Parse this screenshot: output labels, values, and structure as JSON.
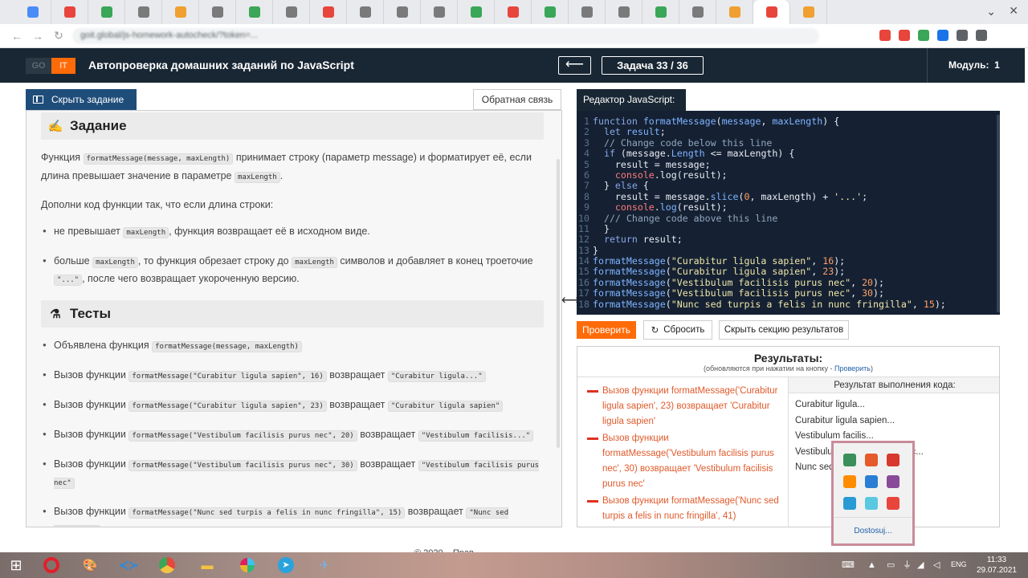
{
  "browser": {
    "tab_count": 22,
    "url_placeholder": "goit.global/js-homework-autocheck/?token=...",
    "tab_colors": [
      "#4a8cf7",
      "#e8453c",
      "#3aa657",
      "#7a7a7a",
      "#f0a030",
      "#7a7a7a",
      "#3aa657",
      "#7a7a7a",
      "#e8453c",
      "#7a7a7a",
      "#7a7a7a",
      "#7a7a7a",
      "#3aa657",
      "#e8453c",
      "#3aa657",
      "#7a7a7a",
      "#7a7a7a",
      "#3aa657",
      "#7a7a7a",
      "#f0a030",
      "#e8453c",
      "#f0a030"
    ],
    "ext_colors": [
      "#e8453c",
      "#e8453c",
      "#3aa657",
      "#1a73e8",
      "#5f6368",
      "#5f6368"
    ]
  },
  "header": {
    "logo_left": "GO",
    "logo_right": "IT",
    "title": "Автопроверка домашних заданий по JavaScript",
    "prev_arrow": "⟵",
    "task_counter": "Задача 33 / 36",
    "module_label": "Модуль:",
    "module_value": "1"
  },
  "left": {
    "hide_task_label": "Скрыть задание",
    "feedback_label": "Обратная связь",
    "task_heading": "Задание",
    "p1_a": "Функция",
    "p1_code": "formatMessage(message, maxLength)",
    "p1_b": "принимает строку (параметр message) и форматирует её, если длина превышает значение в параметре",
    "p1_code2": "maxLength",
    "p1_c": ".",
    "p2": "Дополни код функции так, что если длина строки:",
    "b1_a": "не превышает",
    "b1_code": "maxLength",
    "b1_b": ", функция возвращает её в исходном виде.",
    "b2_a": "больше",
    "b2_code": "maxLength",
    "b2_b": ", то функция обрезает строку до",
    "b2_code2": "maxLength",
    "b2_c": "символов и добавляет в конец троеточие",
    "b2_code3": "\"...\"",
    "b2_d": ", после чего возвращает укороченную версию.",
    "tests_heading": "Тесты",
    "tests": [
      {
        "a": "Объявлена функция",
        "code": "formatMessage(message, maxLength)",
        "b": "",
        "code2": ""
      },
      {
        "a": "Вызов функции",
        "code": "formatMessage(\"Curabitur ligula sapien\", 16)",
        "b": "возвращает",
        "code2": "\"Curabitur ligula...\""
      },
      {
        "a": "Вызов функции",
        "code": "formatMessage(\"Curabitur ligula sapien\", 23)",
        "b": "возвращает",
        "code2": "\"Curabitur ligula sapien\""
      },
      {
        "a": "Вызов функции",
        "code": "formatMessage(\"Vestibulum facilisis purus nec\", 20)",
        "b": "возвращает",
        "code2": "\"Vestibulum facilisis...\""
      },
      {
        "a": "Вызов функции",
        "code": "formatMessage(\"Vestibulum facilisis purus nec\", 30)",
        "b": "возвращает",
        "code2": "\"Vestibulum facilisis purus nec\""
      },
      {
        "a": "Вызов функции",
        "code": "formatMessage(\"Nunc sed turpis a felis in nunc fringilla\", 15)",
        "b": "возвращает",
        "code2": "\"Nunc sed turpis...\""
      }
    ]
  },
  "editor": {
    "tab_label": "Редактор JavaScript:",
    "line_numbers": [
      "1",
      "2",
      "3",
      "4",
      "5",
      "6",
      "7",
      "8",
      "9",
      "10",
      "11",
      "12",
      "13",
      "14",
      "15",
      "16",
      "17",
      "18"
    ],
    "check_label": "Проверить",
    "reset_label": "Сбросить",
    "hide_results_label": "Скрыть секцию результатов"
  },
  "results": {
    "title": "Результаты:",
    "subtitle": "(обновляются при нажатии на кнопку -",
    "subtitle_link": "Проверить",
    "subtitle_end": ")",
    "output_header": "Результат выполнения кода:",
    "failures": [
      "Вызов функции formatMessage('Curabitur ligula sapien', 23) возвращает 'Curabitur ligula sapien'",
      "Вызов функции formatMessage('Vestibulum facilisis purus nec', 30) возвращает 'Vestibulum facilisis purus nec'",
      "Вызов функции formatMessage('Nunc sed turpis a felis in nunc fringilla', 41)"
    ],
    "outputs": [
      "Curabitur ligula...",
      "Curabitur ligula sapien...",
      "Vestibulum facilis...",
      "Vestibulum facilisis purus nec...",
      "Nunc sed turpis..."
    ]
  },
  "footer": {
    "text": "© 2020 – Прав..."
  },
  "taskbar": {
    "lang": "ENG",
    "time": "11:33",
    "date": "29.07.2021",
    "tray_popup_link": "Dostosuj...",
    "tray_icon_colors": [
      "#3a8f5a",
      "#e55a2b",
      "#d9382f",
      "#ff8c00",
      "#2a7fd4",
      "#8a4a9a",
      "#2a9ad4",
      "#5ac8e0",
      "#e8453c"
    ]
  }
}
